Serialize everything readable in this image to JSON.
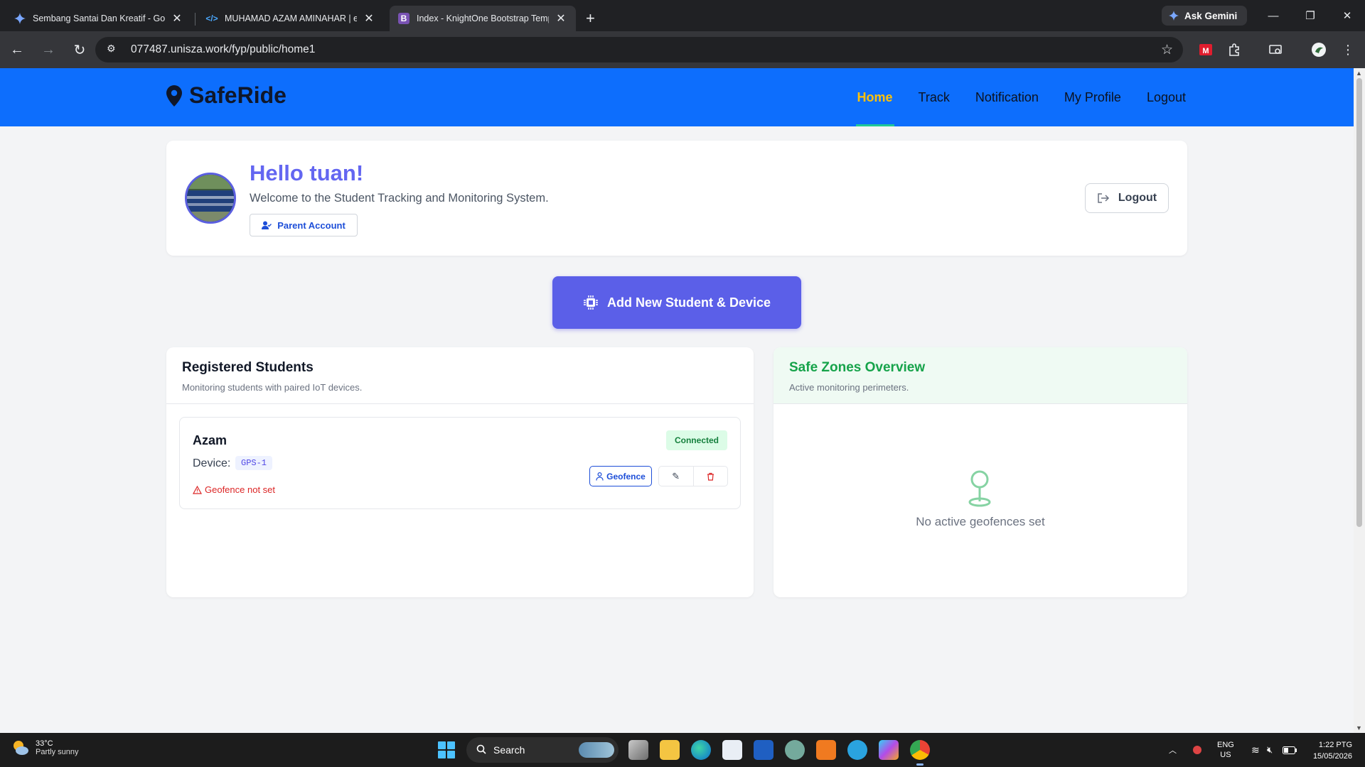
{
  "browser": {
    "tabs": [
      {
        "title": "Sembang Santai Dan Kreatif - Goo",
        "icon": "gemini-icon"
      },
      {
        "title": "MUHAMAD AZAM AMINAHAR | e",
        "icon": "code-icon"
      },
      {
        "title": "Index - KnightOne Bootstrap Temp",
        "icon": "bootstrap-icon"
      }
    ],
    "new_tab": "+",
    "ask_gemini": "Ask Gemini",
    "url": "077487.unisza.work/fyp/public/home1"
  },
  "site": {
    "brand": "SafeRide",
    "nav": [
      {
        "label": "Home",
        "active": true
      },
      {
        "label": "Track",
        "active": false
      },
      {
        "label": "Notification",
        "active": false
      },
      {
        "label": "My Profile",
        "active": false
      },
      {
        "label": "Logout",
        "active": false
      }
    ],
    "colors": {
      "nav_bg": "#0d6efd",
      "active_link": "#ffc107",
      "accent": "#6366f1",
      "success": "#16a34a",
      "danger": "#dc2626"
    }
  },
  "hello": {
    "greeting": "Hello tuan!",
    "welcome": "Welcome to the Student Tracking and Monitoring System.",
    "account_button": "Parent Account",
    "logout_button": "Logout"
  },
  "actions": {
    "add_student": "Add New Student & Device"
  },
  "students": {
    "title": "Registered Students",
    "subtitle": "Monitoring students with paired IoT devices.",
    "items": [
      {
        "name": "Azam",
        "device_label": "Device:",
        "device": "GPS-1",
        "status": "Connected",
        "warning": "Geofence not set",
        "geofence_button": "Geofence"
      }
    ]
  },
  "zones": {
    "title": "Safe Zones Overview",
    "subtitle": "Active monitoring perimeters.",
    "empty": "No active geofences set"
  },
  "taskbar": {
    "temp": "33°C",
    "weather": "Partly sunny",
    "search": "Search",
    "lang1": "ENG",
    "lang2": "US",
    "time": "1:22 PTG",
    "date": "15/05/2026"
  }
}
